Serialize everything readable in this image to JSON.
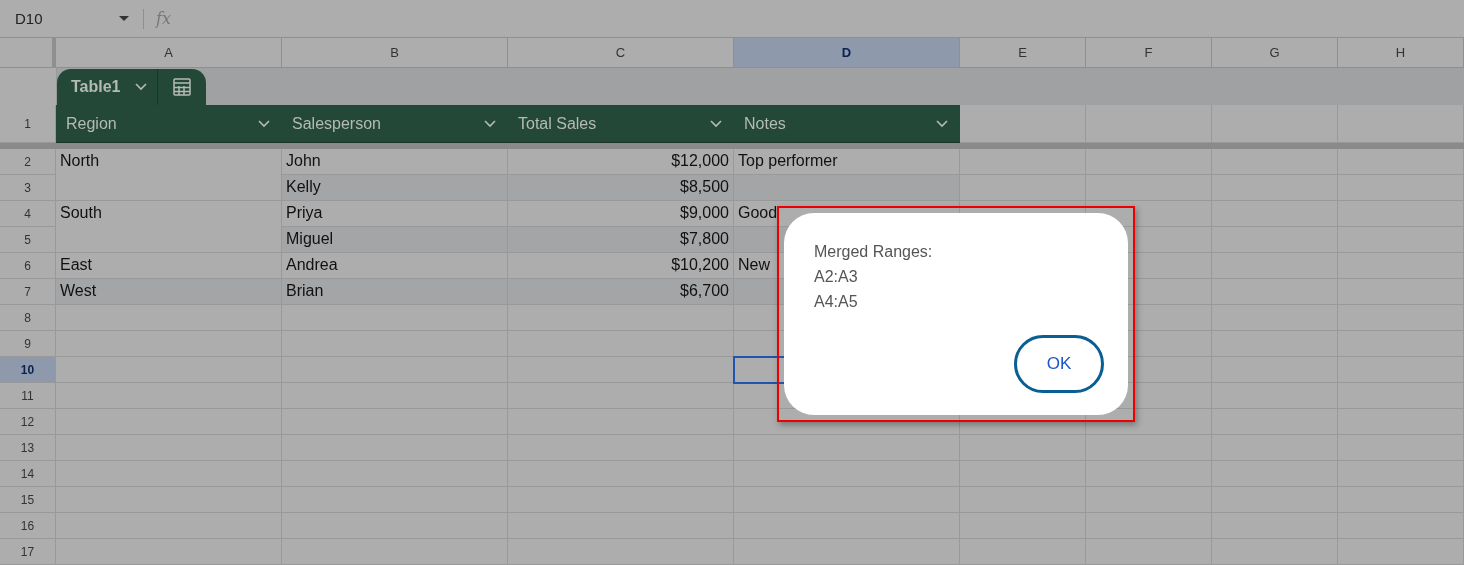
{
  "toolbar": {
    "name_box": "D10",
    "formula_label": "fx"
  },
  "columns": [
    {
      "label": "A",
      "selected": false
    },
    {
      "label": "B",
      "selected": false
    },
    {
      "label": "C",
      "selected": false
    },
    {
      "label": "D",
      "selected": true
    },
    {
      "label": "E",
      "selected": false
    },
    {
      "label": "F",
      "selected": false
    },
    {
      "label": "G",
      "selected": false
    },
    {
      "label": "H",
      "selected": false
    }
  ],
  "table": {
    "name": "Table1",
    "header_row": "1",
    "headers": [
      "Region",
      "Salesperson",
      "Total Sales",
      "Notes"
    ],
    "rows": [
      {
        "region": "North",
        "region_merged": true,
        "salesperson": "John",
        "total_sales": "$12,000",
        "notes": "Top performer"
      },
      {
        "salesperson": "Kelly",
        "total_sales": "$8,500"
      },
      {
        "region": "South",
        "region_merged": true,
        "salesperson": "Priya",
        "total_sales": "$9,000",
        "notes": "Good"
      },
      {
        "salesperson": "Miguel",
        "total_sales": "$7,800"
      },
      {
        "region": "East",
        "region_merged": false,
        "salesperson": "Andrea",
        "total_sales": "$10,200",
        "notes": "New"
      },
      {
        "region": "West",
        "region_merged": false,
        "salesperson": "Brian",
        "total_sales": "$6,700"
      }
    ]
  },
  "row_headers": [
    {
      "label": "2",
      "selected": false
    },
    {
      "label": "3",
      "selected": false
    },
    {
      "label": "4",
      "selected": false
    },
    {
      "label": "5",
      "selected": false
    },
    {
      "label": "6",
      "selected": false
    },
    {
      "label": "7",
      "selected": false
    },
    {
      "label": "8",
      "selected": false
    },
    {
      "label": "9",
      "selected": false
    },
    {
      "label": "10",
      "selected": true
    },
    {
      "label": "11",
      "selected": false
    },
    {
      "label": "12",
      "selected": false
    },
    {
      "label": "13",
      "selected": false
    },
    {
      "label": "14",
      "selected": false
    },
    {
      "label": "15",
      "selected": false
    },
    {
      "label": "16",
      "selected": false
    },
    {
      "label": "17",
      "selected": false
    }
  ],
  "dialog": {
    "highlighted": true,
    "lines": [
      "Merged Ranges:",
      "A2:A3",
      "A4:A5"
    ],
    "button": "OK"
  }
}
